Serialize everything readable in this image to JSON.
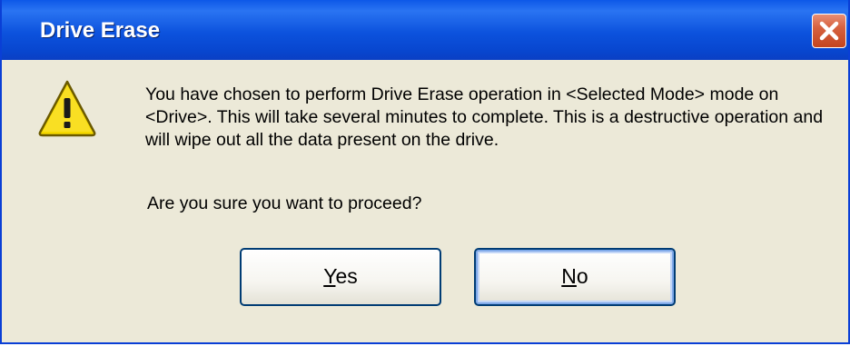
{
  "window": {
    "title": "Drive Erase"
  },
  "dialog": {
    "icon": "warning-icon",
    "message": "You have chosen to perform Drive Erase operation in <Selected Mode> mode on <Drive>. This will take several minutes to complete. This is a destructive operation and will wipe out all the data present on the drive.",
    "question": "Are you sure you want to proceed?"
  },
  "buttons": {
    "yes": {
      "mnemonic": "Y",
      "rest": "es"
    },
    "no": {
      "mnemonic": "N",
      "rest": "o"
    }
  },
  "colors": {
    "titlebar": "#0c52dd",
    "close": "#c4451e",
    "body": "#ece9d8",
    "warning": "#f5d800"
  }
}
